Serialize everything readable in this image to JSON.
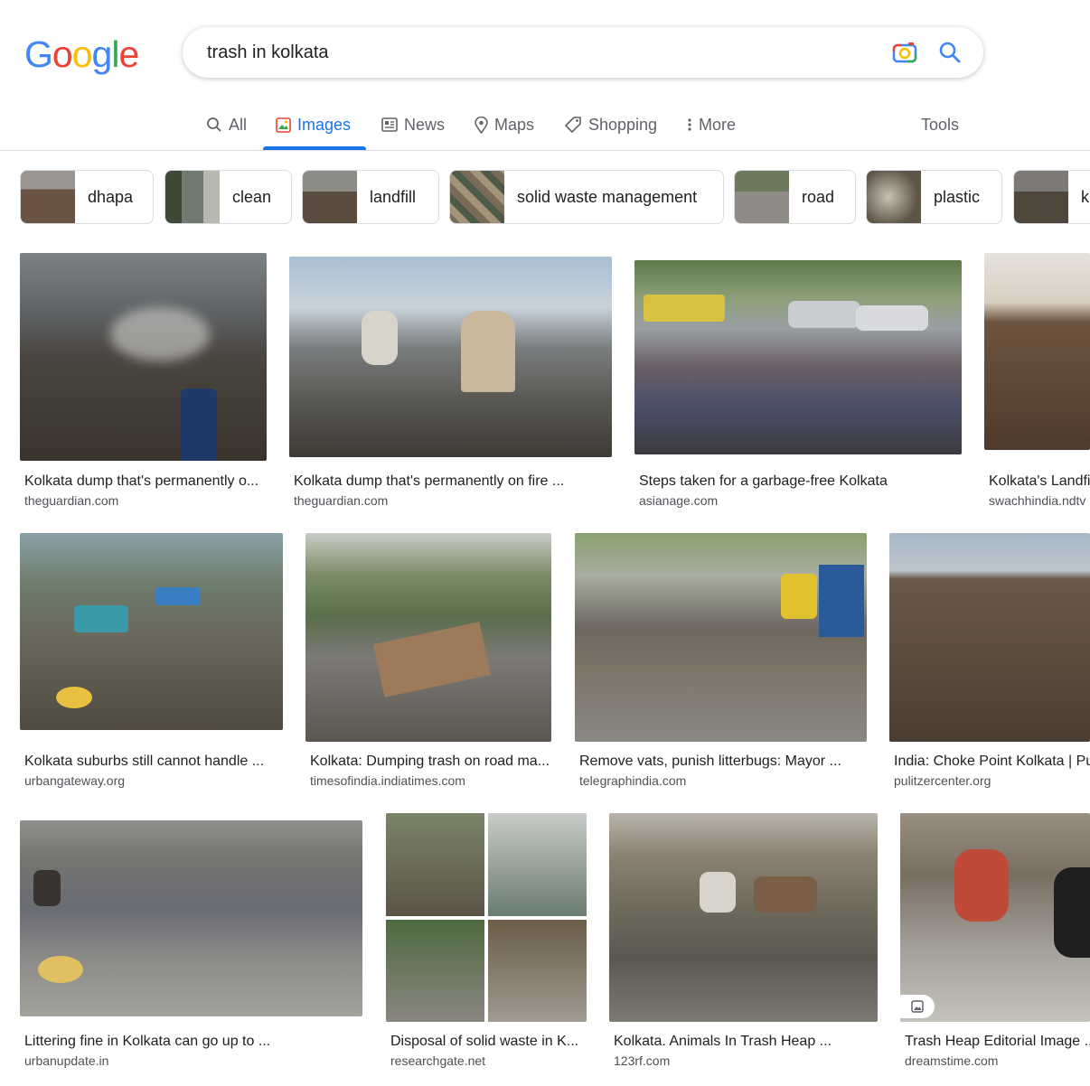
{
  "logo": {
    "letters": [
      "G",
      "o",
      "o",
      "g",
      "l",
      "e"
    ],
    "colors": [
      "#4285f4",
      "#ea4335",
      "#fbbc05",
      "#4285f4",
      "#34a853",
      "#ea4335"
    ]
  },
  "search": {
    "query": "trash in kolkata"
  },
  "tabs": [
    {
      "label": "All",
      "icon": "search-icon"
    },
    {
      "label": "Images",
      "icon": "image-icon",
      "active": true
    },
    {
      "label": "News",
      "icon": "news-icon"
    },
    {
      "label": "Maps",
      "icon": "map-pin-icon"
    },
    {
      "label": "Shopping",
      "icon": "tag-icon"
    },
    {
      "label": "More",
      "icon": "more-vert-icon"
    }
  ],
  "tools_label": "Tools",
  "chips": [
    {
      "label": "dhapa"
    },
    {
      "label": "clean"
    },
    {
      "label": "landfill"
    },
    {
      "label": "solid waste management"
    },
    {
      "label": "road"
    },
    {
      "label": "plastic"
    },
    {
      "label": "k"
    }
  ],
  "results": [
    {
      "title": "Kolkata dump that's permanently o...",
      "site": "theguardian.com"
    },
    {
      "title": "Kolkata dump that's permanently on fire ...",
      "site": "theguardian.com"
    },
    {
      "title": "Steps taken for a garbage-free Kolkata",
      "site": "asianage.com"
    },
    {
      "title": "Kolkata's Landfi",
      "site": "swachhindia.ndtv"
    },
    {
      "title": "Kolkata suburbs still cannot handle ...",
      "site": "urbangateway.org"
    },
    {
      "title": "Kolkata: Dumping trash on road ma...",
      "site": "timesofindia.indiatimes.com"
    },
    {
      "title": "Remove vats, punish litterbugs: Mayor ...",
      "site": "telegraphindia.com"
    },
    {
      "title": "India: Choke Point Kolkata | Pu",
      "site": "pulitzercenter.org"
    },
    {
      "title": "Littering fine in Kolkata can go up to ...",
      "site": "urbanupdate.in"
    },
    {
      "title": "Disposal of solid waste in K...",
      "site": "researchgate.net"
    },
    {
      "title": "Kolkata. Animals In Trash Heap ...",
      "site": "123rf.com"
    },
    {
      "title": "Trash Heap Editorial Image ...",
      "site": "dreamstime.com"
    }
  ]
}
